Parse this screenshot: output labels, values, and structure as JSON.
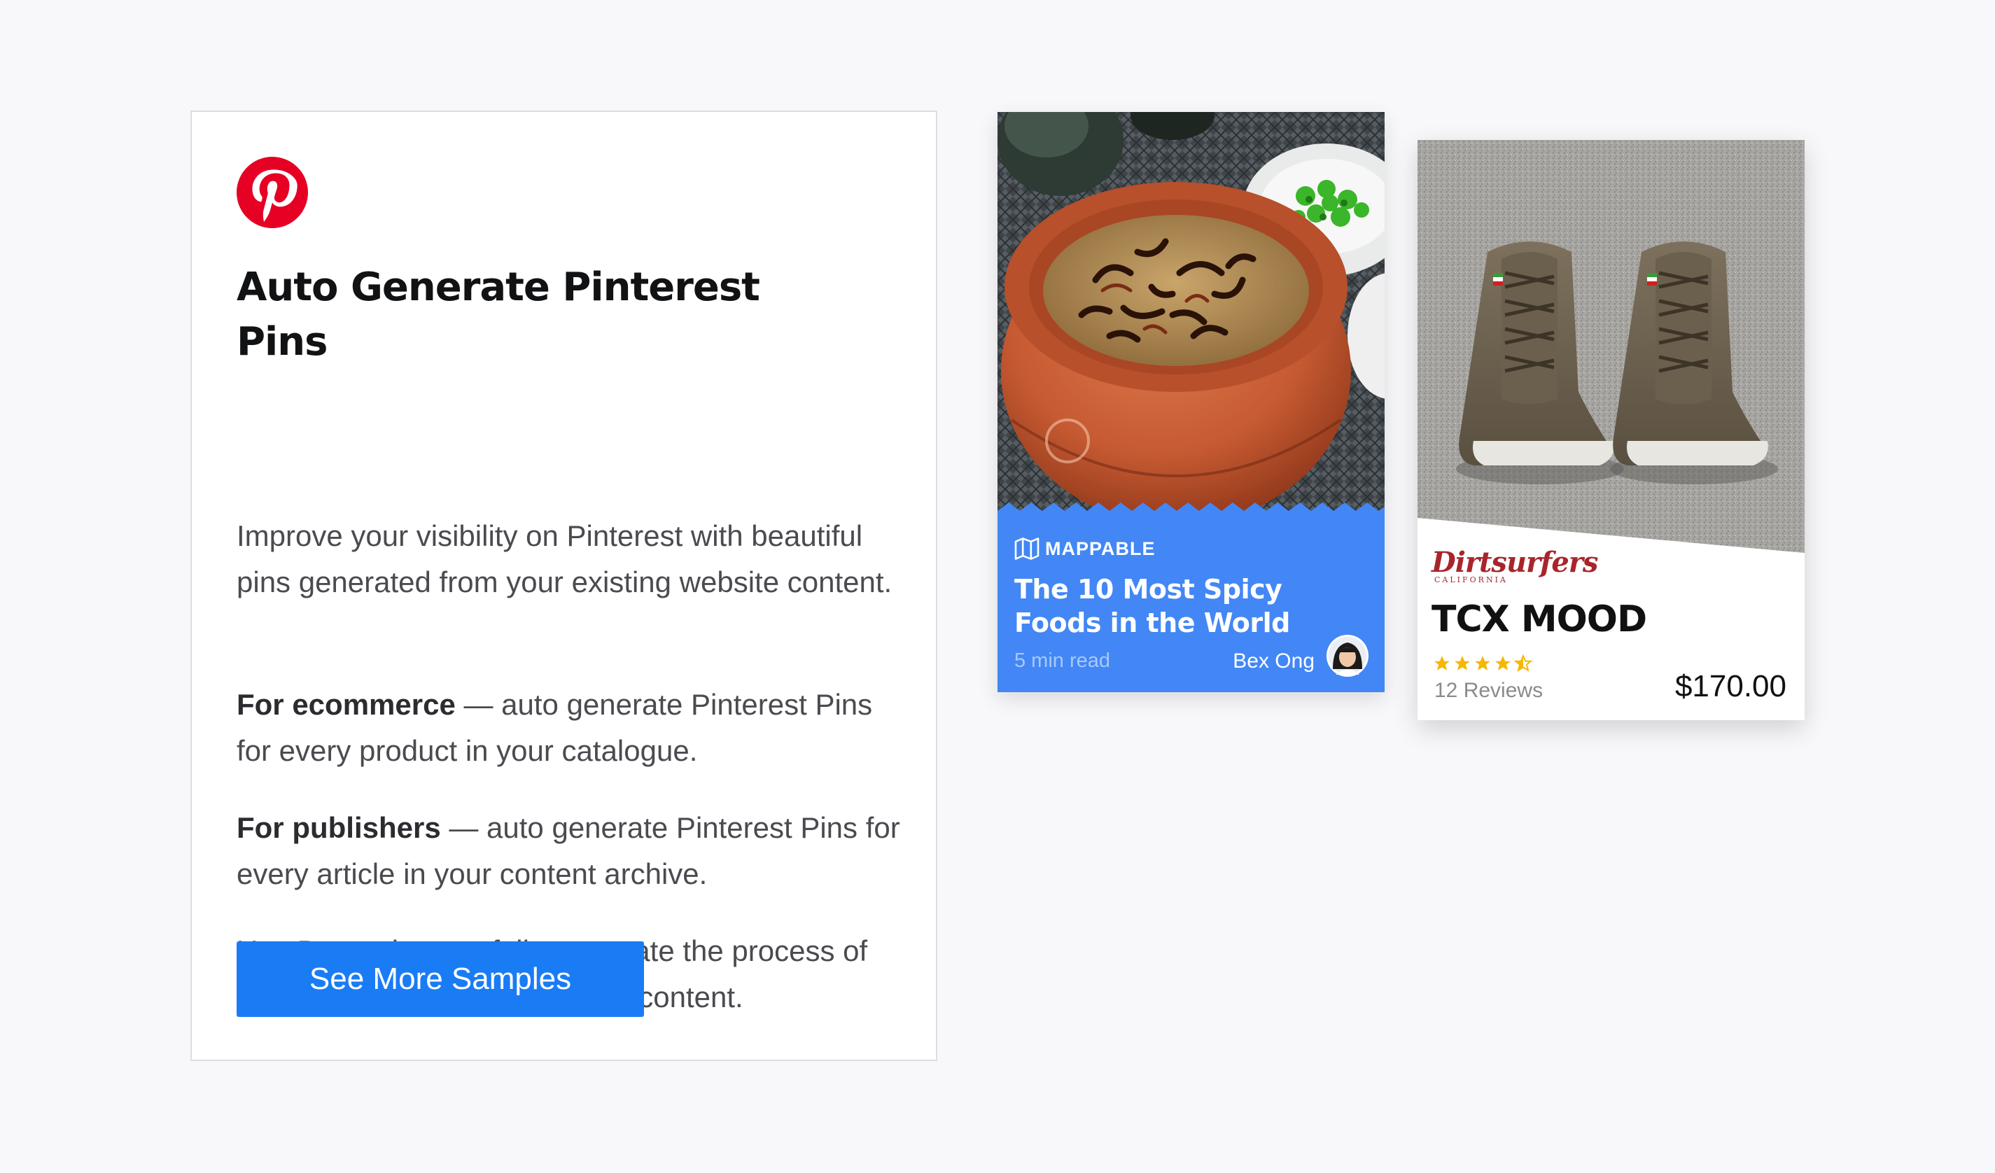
{
  "info": {
    "logo_icon": "pinterest-logo-icon",
    "brand_color": "#e60023",
    "title": "Auto Generate Pinterest Pins",
    "intro": "Improve your visibility on Pinterest with beautiful pins generated from your existing website content.",
    "ecommerce_label": "For ecommerce",
    "ecommerce_text": " — auto generate Pinterest Pins for every product in your catalogue.",
    "publishers_label": "For publishers",
    "publishers_text": " — auto generate Pinterest Pins for every article in your content archive.",
    "closing": "Use Bannerbear to fully automate the process of making eye-catching Pinterest content.",
    "button_label": "See More Samples",
    "button_color": "#1a7cf5"
  },
  "pin_article": {
    "image": "spicy-food-bowl-photo",
    "brand_icon": "map-icon",
    "brand": "MAPPABLE",
    "headline": "The 10 Most Spicy Foods in the World",
    "read_time": "5 min read",
    "author": "Bex Ong",
    "avatar": "author-avatar",
    "accent": "#4287f5"
  },
  "pin_product": {
    "image": "sneakers-photo",
    "store": "Dirtsurfers",
    "store_sub": "CALIFORNIA",
    "product": "TCX MOOD",
    "rating": 4.5,
    "rating_max": 5,
    "reviews": "12 Reviews",
    "price": "$170.00",
    "star_color": "#f5b700"
  }
}
